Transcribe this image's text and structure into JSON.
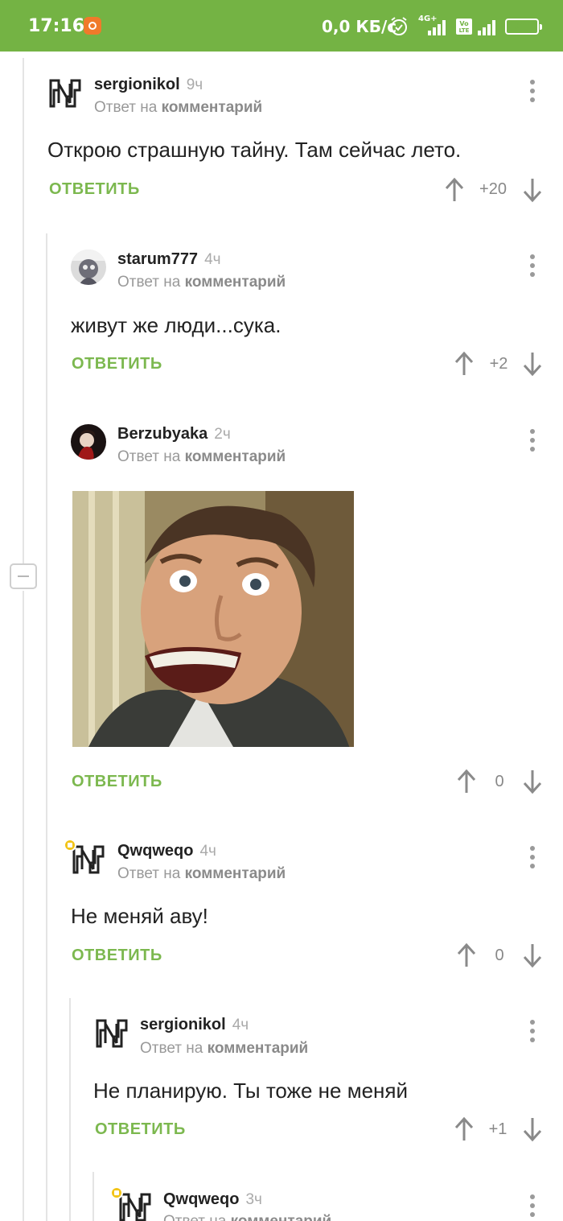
{
  "status_bar": {
    "time": "17:16",
    "network_speed": "0,0 КБ/с",
    "signal_1": "4G+",
    "signal_2": "Vo LTE",
    "battery": "94",
    "battery_level": 0.94,
    "bar_color": "#74b344"
  },
  "ui": {
    "reply_label": "ОТВЕТИТЬ",
    "reply_to_prefix": "Ответ на",
    "reply_to_link": "комментарий",
    "accent_color": "#7cb84f"
  },
  "comments": [
    {
      "author": "sergionikol",
      "time": "9ч",
      "text": "Открою страшную тайну. Там сейчас лето.",
      "rating": "+20",
      "avatar": "rammstein-logo-icon"
    },
    {
      "author": "starum777",
      "time": "4ч",
      "text": "живут же люди...сука.",
      "rating": "+2",
      "avatar": "user-photo-avatar"
    },
    {
      "author": "Berzubyaka",
      "time": "2ч",
      "text": "",
      "rating": "0",
      "avatar": "user-photo-avatar",
      "image": "nicolas-cage-meme-image"
    },
    {
      "author": "Qwqweqo",
      "time": "4ч",
      "text": "Не меняй аву!",
      "rating": "0",
      "avatar": "rammstein-logo-icon",
      "badge": "pin-badge-icon"
    },
    {
      "author": "sergionikol",
      "time": "4ч",
      "text": "Не планирую. Ты тоже не меняй",
      "rating": "+1",
      "avatar": "rammstein-logo-icon"
    },
    {
      "author": "Qwqweqo",
      "time": "3ч",
      "text": "",
      "rating": "",
      "avatar": "rammstein-logo-icon",
      "badge": "pin-badge-icon"
    }
  ]
}
